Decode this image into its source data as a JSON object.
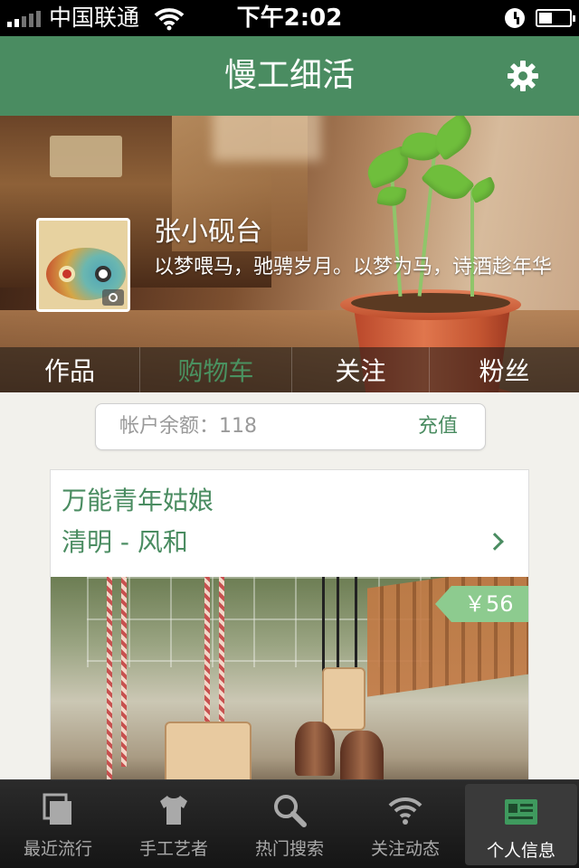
{
  "status_bar": {
    "carrier": "中国联通",
    "time": "下午2:02"
  },
  "nav": {
    "title": "慢工细活",
    "settings_icon": "gear-icon"
  },
  "profile": {
    "name": "张小砚台",
    "bio": "以梦喂马，驰骋岁月。以梦为马，诗酒趁年华",
    "avatar_badge_icon": "camera-icon",
    "tabs": [
      {
        "label": "作品"
      },
      {
        "label": "购物车",
        "active": true
      },
      {
        "label": "关注"
      },
      {
        "label": "粉丝"
      }
    ]
  },
  "balance": {
    "label": "帐户余额：118",
    "action": "充值"
  },
  "card": {
    "title": "万能青年姑娘",
    "subtitle": "清明 - 风和",
    "price": "￥56"
  },
  "tabbar": {
    "items": [
      {
        "label": "最近流行",
        "icon": "stack-icon"
      },
      {
        "label": "手工艺者",
        "icon": "tshirt-icon"
      },
      {
        "label": "热门搜索",
        "icon": "search-icon"
      },
      {
        "label": "关注动态",
        "icon": "wifi-icon"
      },
      {
        "label": "个人信息",
        "icon": "id-card-icon",
        "active": true
      }
    ]
  },
  "colors": {
    "accent": "#4a8c61",
    "price_tag": "#8dcb8f",
    "tabbar": "#1e1e1e"
  }
}
